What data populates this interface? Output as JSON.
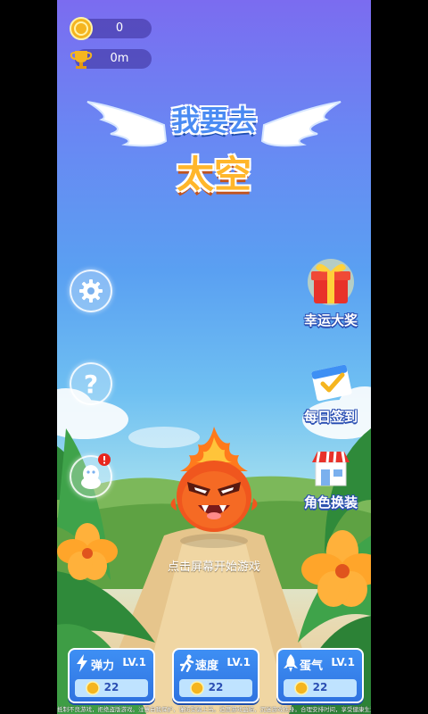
{
  "hud": {
    "coins": "0",
    "distance": "0m"
  },
  "title": {
    "line1": "我要去",
    "line2": "太空"
  },
  "side_menu": {
    "lucky_prize": "幸运大奖",
    "daily_checkin": "每日签到",
    "skin_change": "角色换装"
  },
  "hint": "点击屏幕开始游戏",
  "upgrades": [
    {
      "name": "弹力",
      "level": "LV.1",
      "cost": "22",
      "icon": "lightning-icon"
    },
    {
      "name": "速度",
      "level": "LV.1",
      "cost": "22",
      "icon": "running-icon"
    },
    {
      "name": "蛋气",
      "level": "LV.1",
      "cost": "22",
      "icon": "rocket-icon"
    }
  ],
  "footer": "抵制不良游戏，拒绝盗版游戏。注意自我保护，谨防受骗上当。适度游戏益脑，沉迷游戏伤身。合理安排时间，享受健康生活。",
  "colors": {
    "button_blue": "#3e8ff4",
    "title_orange": "#ffb62b",
    "title_blue": "#4a8bf3"
  }
}
